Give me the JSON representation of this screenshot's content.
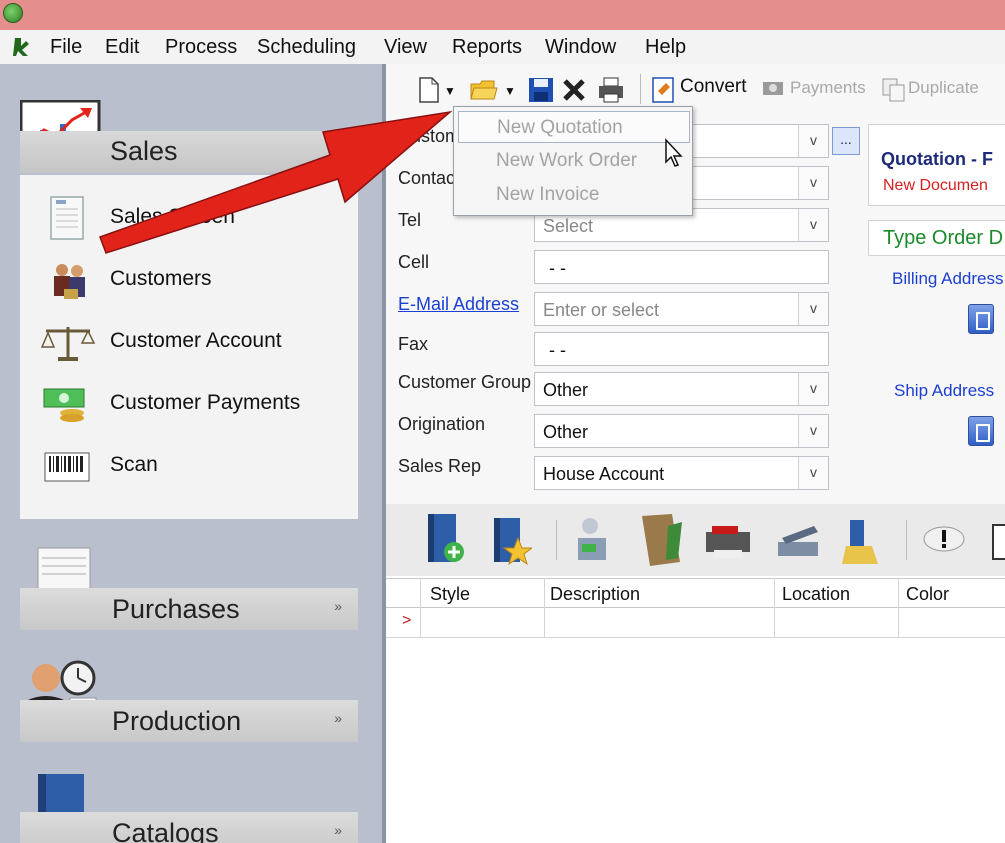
{
  "menubar": {
    "items": [
      "File",
      "Edit",
      "Process",
      "Scheduling",
      "View",
      "Reports",
      "Window",
      "Help"
    ]
  },
  "sidebar": {
    "sales_title": "Sales",
    "sales_items": [
      {
        "label": "Sales Screen",
        "icon": "document-icon"
      },
      {
        "label": "Customers",
        "icon": "customers-icon"
      },
      {
        "label": "Customer Account",
        "icon": "scales-icon"
      },
      {
        "label": "Customer Payments",
        "icon": "money-icon"
      },
      {
        "label": "Scan",
        "icon": "barcode-icon"
      }
    ],
    "groups": [
      {
        "label": "Purchases",
        "chevron": "»"
      },
      {
        "label": "Production",
        "chevron": "»"
      },
      {
        "label": "Catalogs",
        "chevron": "»"
      }
    ]
  },
  "toolbar": {
    "convert_label": "Convert",
    "payments_label": "Payments",
    "duplicate_label": "Duplicate"
  },
  "new_menu": {
    "items": [
      "New Quotation",
      "New Work Order",
      "New Invoice"
    ],
    "highlighted_index": 0
  },
  "form": {
    "labels": {
      "customer": "Custom",
      "contact": "Contac",
      "tel": "Tel",
      "cell": "Cell",
      "email": "E-Mail Address",
      "fax": "Fax",
      "customer_group": "Customer Group",
      "origination": "Origination",
      "sales_rep": "Sales Rep"
    },
    "values": {
      "tel_placeholder": "Select",
      "cell": "-  -",
      "email_placeholder": "Enter or select",
      "fax": "-  -",
      "customer_group": "Other",
      "origination": "Other",
      "sales_rep": "House Account"
    },
    "ellipsis": "...",
    "dropdown_glyph": "v"
  },
  "right_panel": {
    "title": "Quotation - F",
    "status": "New Documen",
    "type_order": "Type Order D",
    "billing_address": "Billing Address",
    "ship_address": "Ship Address"
  },
  "grid": {
    "columns": [
      "Style",
      "Description",
      "Location",
      "Color"
    ],
    "row_marker": ">"
  },
  "colors": {
    "titlebar": "#e58e8e",
    "nav_bg": "#b9bfcd",
    "arrow_red": "#e2231a",
    "link_blue": "#1a3fd1",
    "status_red": "#d61e1e",
    "type_order_green": "#1c8a2b"
  }
}
